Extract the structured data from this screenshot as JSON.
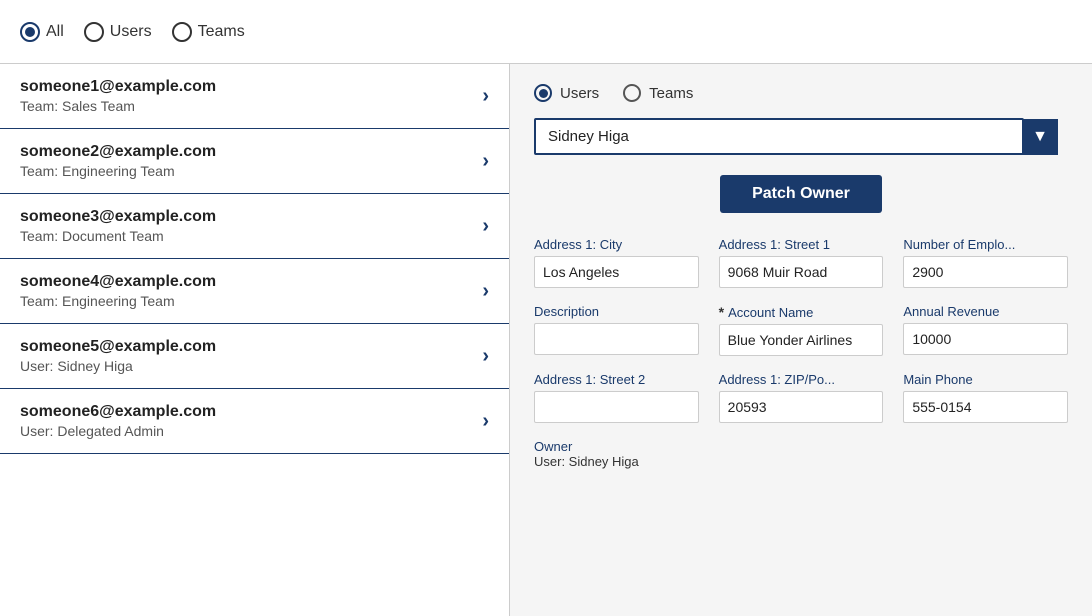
{
  "top_filter": {
    "options": [
      {
        "id": "all",
        "label": "All",
        "selected": true
      },
      {
        "id": "users",
        "label": "Users",
        "selected": false
      },
      {
        "id": "teams",
        "label": "Teams",
        "selected": false
      }
    ]
  },
  "list": {
    "items": [
      {
        "email": "someone1@example.com",
        "sub": "Team: Sales Team"
      },
      {
        "email": "someone2@example.com",
        "sub": "Team: Engineering Team"
      },
      {
        "email": "someone3@example.com",
        "sub": "Team: Document Team"
      },
      {
        "email": "someone4@example.com",
        "sub": "Team: Engineering Team"
      },
      {
        "email": "someone5@example.com",
        "sub": "User: Sidney Higa"
      },
      {
        "email": "someone6@example.com",
        "sub": "User: Delegated Admin"
      }
    ]
  },
  "right_panel": {
    "filter_options": [
      {
        "id": "users",
        "label": "Users",
        "selected": true
      },
      {
        "id": "teams",
        "label": "Teams",
        "selected": false
      }
    ],
    "dropdown": {
      "selected_value": "Sidney Higa",
      "chevron": "▼"
    },
    "patch_owner_button": "Patch Owner",
    "fields": [
      {
        "label": "Address 1: City",
        "value": "Los Angeles",
        "required": false,
        "col": 1
      },
      {
        "label": "Address 1: Street 1",
        "value": "9068 Muir Road",
        "required": false,
        "col": 2
      },
      {
        "label": "Number of Emplo...",
        "value": "2900",
        "required": false,
        "col": 3
      },
      {
        "label": "Description",
        "value": "",
        "required": false,
        "col": 1
      },
      {
        "label": "Account Name",
        "value": "Blue Yonder Airlines",
        "required": true,
        "col": 2
      },
      {
        "label": "Annual Revenue",
        "value": "10000",
        "required": false,
        "col": 3
      },
      {
        "label": "Address 1: Street 2",
        "value": "",
        "required": false,
        "col": 1
      },
      {
        "label": "Address 1: ZIP/Po...",
        "value": "20593",
        "required": false,
        "col": 2
      },
      {
        "label": "Main Phone",
        "value": "555-0154",
        "required": false,
        "col": 3
      }
    ],
    "owner": {
      "label": "Owner",
      "value": "User: Sidney Higa"
    }
  }
}
